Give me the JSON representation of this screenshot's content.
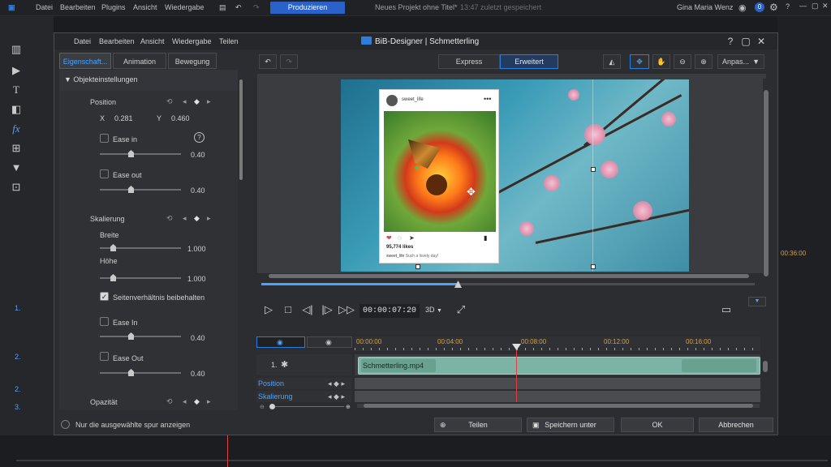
{
  "app": {
    "menu": [
      "Datei",
      "Bearbeiten",
      "Plugins",
      "Ansicht",
      "Wiedergabe"
    ],
    "produce_label": "Produzieren",
    "project_title": "Neues Projekt ohne Titel*",
    "last_saved": "13:47 zuletzt gespeichert",
    "user": "Gina Maria Wenz",
    "track_labels": [
      "1.",
      "2.",
      "2.",
      "3.",
      "3."
    ],
    "right_timecode": "00:36:00"
  },
  "dialog": {
    "menu": [
      "Datei",
      "Bearbeiten",
      "Ansicht",
      "Wiedergabe",
      "Teilen"
    ],
    "title": "BiB-Designer | Schmetterling",
    "help": "?",
    "tabs": [
      "Eigenschaft...",
      "Animation",
      "Bewegung"
    ],
    "object_settings": "Objekteinstellungen",
    "position": {
      "label": "Position",
      "x_label": "X",
      "x_value": "0.281",
      "y_label": "Y",
      "y_value": "0.460",
      "ease_in_label": "Ease in",
      "ease_in_value": "0.40",
      "ease_out_label": "Ease out",
      "ease_out_value": "0.40"
    },
    "scaling": {
      "label": "Skalierung",
      "width_label": "Breite",
      "width_value": "1.000",
      "height_label": "Höhe",
      "height_value": "1.000",
      "keep_ratio_label": "Seitenverhältnis beibehalten",
      "ease_in_label": "Ease In",
      "ease_in_value": "0.40",
      "ease_out_label": "Ease Out",
      "ease_out_value": "0.40"
    },
    "opacity_label": "Opazität",
    "only_selected_label": "Nur die ausgewählte spur anzeigen",
    "mode_express": "Express",
    "mode_advanced": "Erweitert",
    "zoom_label": "Anpas...",
    "timecode": "00:00:07:20",
    "view_3d": "3D",
    "card": {
      "username": "sweet_life",
      "likes": "95,774 likes",
      "caption_user": "sweet_life",
      "caption": "Such a lovely day!"
    },
    "timeline": {
      "ruler": [
        "00:00:00",
        "00:04:00",
        "00:08:00",
        "00:12:00",
        "00:16:00"
      ],
      "track_number": "1.",
      "clip_name": "Schmetterling.mp4",
      "rows": [
        "Position",
        "Skalierung"
      ]
    },
    "buttons": {
      "share": "Teilen",
      "save_as": "Speichern unter",
      "ok": "OK",
      "cancel": "Abbrechen"
    }
  },
  "colors": {
    "accent": "#2b7de0",
    "playhead": "#e04040",
    "clip": "#7db3a5",
    "timecode": "#d4a24a"
  }
}
